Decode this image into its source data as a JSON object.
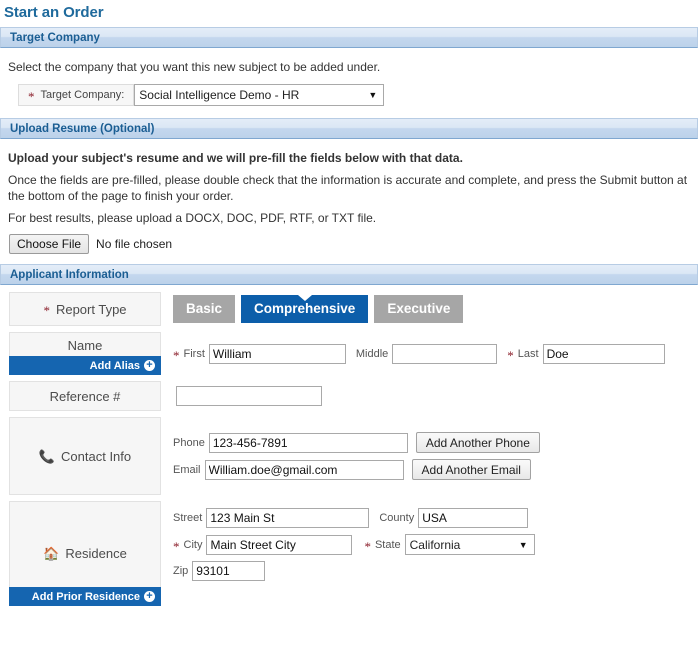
{
  "page": {
    "title": "Start an Order"
  },
  "target_company": {
    "section_title": "Target Company",
    "instruction": "Select the company that you want this new subject to be added under.",
    "label": "Target Company:",
    "required_mark": "*",
    "selected": "Social Intelligence Demo - HR",
    "options": [
      "Social Intelligence Demo - HR"
    ],
    "dropdown_arrow": "▼"
  },
  "upload_resume": {
    "section_title": "Upload Resume (Optional)",
    "line1": "Upload your subject's resume and we will pre-fill the fields below with that data.",
    "line2": "Once the fields are pre-filled, please double check that the information is accurate and complete, and press the Submit button at the bottom of the page to finish your order.",
    "line3": "For best results, please upload a DOCX, DOC, PDF, RTF, or TXT file.",
    "choose_file_label": "Choose File",
    "file_status": "No file chosen"
  },
  "applicant": {
    "section_title": "Applicant Information",
    "report_type": {
      "label": "Report Type",
      "required_mark": "*",
      "tabs": [
        {
          "label": "Basic",
          "selected": false
        },
        {
          "label": "Comprehensive",
          "selected": true
        },
        {
          "label": "Executive",
          "selected": false
        }
      ]
    },
    "name": {
      "label": "Name",
      "add_button": "Add Alias",
      "add_icon": "plus-circle-icon",
      "first_label": "First",
      "first_value": "William",
      "first_required": "*",
      "middle_label": "Middle",
      "middle_value": "",
      "last_label": "Last",
      "last_value": "Doe",
      "last_required": "*"
    },
    "reference": {
      "label": "Reference #",
      "value": ""
    },
    "contact": {
      "label": "Contact Info",
      "icon": "phone-icon",
      "phone_label": "Phone",
      "phone_value": "123-456-7891",
      "add_phone_label": "Add Another Phone",
      "email_label": "Email",
      "email_value": "William.doe@gmail.com",
      "add_email_label": "Add Another Email"
    },
    "residence": {
      "label": "Residence",
      "icon": "home-icon",
      "add_button": "Add Prior Residence",
      "add_icon": "plus-circle-icon",
      "street_label": "Street",
      "street_value": "123 Main St",
      "county_label": "County",
      "county_value": "USA",
      "city_label": "City",
      "city_value": "Main Street City",
      "city_required": "*",
      "state_label": "State",
      "state_value": "California",
      "state_required": "*",
      "state_options": [
        "California"
      ],
      "zip_label": "Zip",
      "zip_value": "93101",
      "dropdown_arrow": "▼"
    }
  },
  "colors": {
    "title_blue": "#1f6a9c",
    "accent_blue": "#0c5eaa",
    "add_button_blue": "#1565b0",
    "tab_grey": "#a6a6a6",
    "required_red": "#8b1f2b"
  }
}
